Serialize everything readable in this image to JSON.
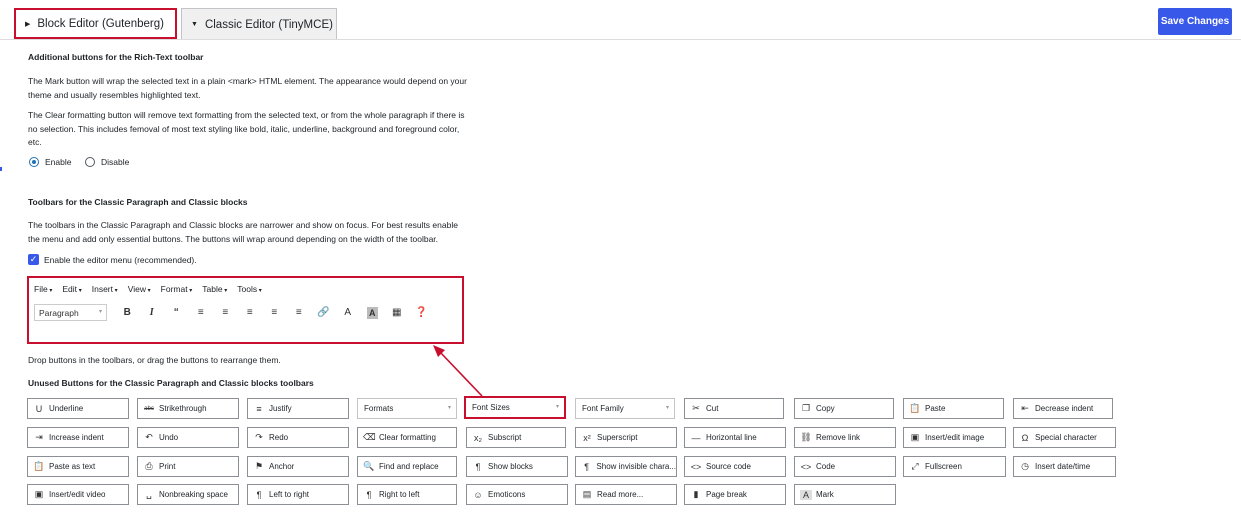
{
  "tabs": [
    {
      "label": "Block Editor (Gutenberg)",
      "active": true
    },
    {
      "label": "Classic Editor (TinyMCE)",
      "active": false
    }
  ],
  "save_label": "Save Changes",
  "section1": {
    "heading": "Additional buttons for the Rich-Text toolbar",
    "mark_text": "The Mark button will wrap the selected text in a plain <mark> HTML element. The appearance would depend on your theme and usually resembles highlighted text.",
    "clear_text": "The Clear formatting button will remove text formatting from the selected text, or from the whole paragraph if there is no selection. This includes femoval of most text styling like bold, italic, underline, background and foreground color, etc.",
    "enable_label": "Enable",
    "disable_label": "Disable",
    "selected": "Enable"
  },
  "section2": {
    "heading": "Toolbars for the Classic Paragraph and Classic blocks",
    "text": "The toolbars in the Classic Paragraph and Classic blocks are narrower and show on focus. For best results enable the menu and add only essential buttons. The buttons will wrap around depending on the width of the toolbar.",
    "menu_checkbox_label": "Enable the editor menu (recommended).",
    "menu_checked": true
  },
  "editor": {
    "menu": [
      "File",
      "Edit",
      "Insert",
      "View",
      "Format",
      "Table",
      "Tools"
    ],
    "format_select": "Paragraph",
    "toolbar_icons": [
      "bold-icon",
      "italic-icon",
      "blockquote-icon",
      "bullet-list-icon",
      "numbered-list-icon",
      "align-left-icon",
      "align-center-icon",
      "align-right-icon",
      "link-icon",
      "text-color-icon",
      "background-color-icon",
      "table-icon",
      "help-icon"
    ]
  },
  "drop_hint": "Drop buttons in the toolbars, or drag the buttons to rearrange them.",
  "unused_heading": "Unused Buttons for the Classic Paragraph and Classic blocks toolbars",
  "buttons": [
    [
      "Underline",
      "Strikethrough",
      "Justify",
      "Formats",
      "Font Sizes",
      "Font Family",
      "Cut",
      "Copy",
      "Paste",
      "Decrease indent"
    ],
    [
      "Increase indent",
      "Undo",
      "Redo",
      "Clear formatting",
      "Subscript",
      "Superscript",
      "Horizontal line",
      "Remove link",
      "Insert/edit image",
      "Special character"
    ],
    [
      "Paste as text",
      "Print",
      "Anchor",
      "Find and replace",
      "Show blocks",
      "Show invisible chara...",
      "Source code",
      "Code",
      "Fullscreen",
      "Insert date/time"
    ],
    [
      "Insert/edit video",
      "Nonbreaking space",
      "Left to right",
      "Right to left",
      "Emoticons",
      "Read more...",
      "Page break",
      "Mark"
    ]
  ],
  "colors": {
    "accent": "#3858e9",
    "highlight": "#c8102e"
  }
}
